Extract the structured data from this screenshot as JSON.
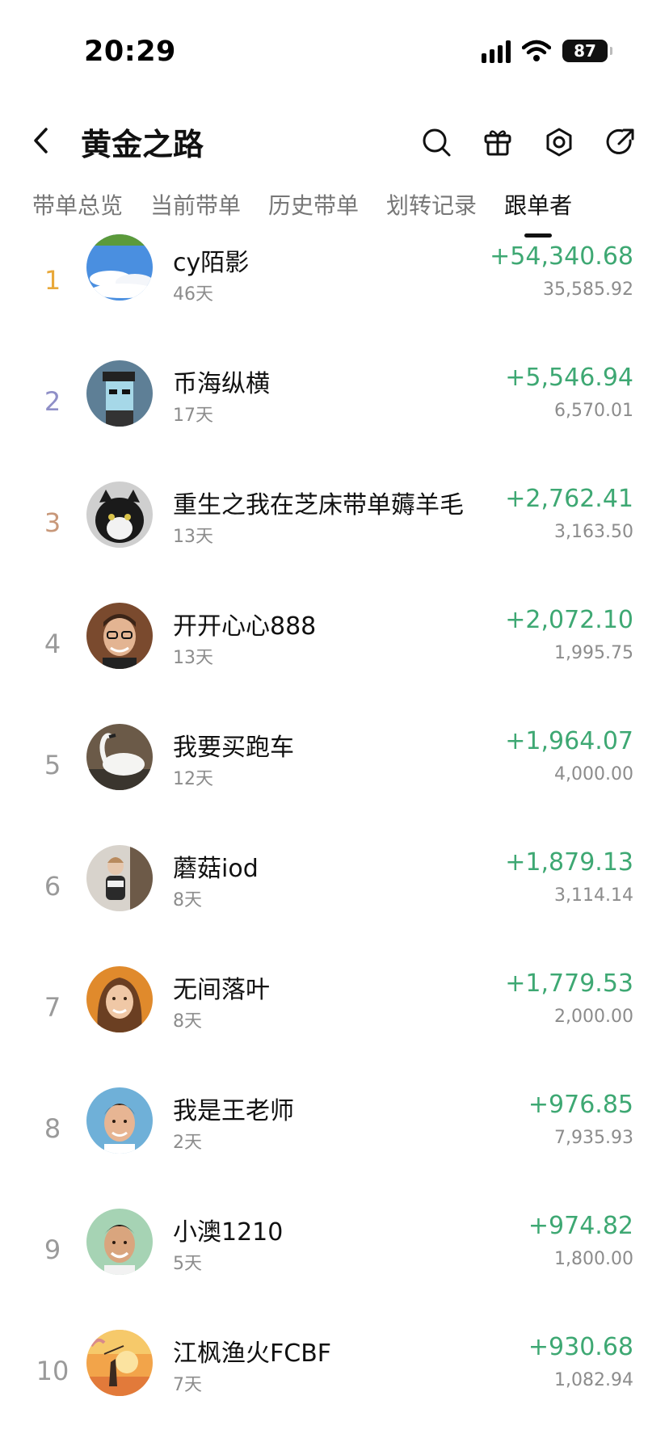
{
  "status_bar": {
    "time": "20:29",
    "battery": "87"
  },
  "header": {
    "title": "黄金之路"
  },
  "tabs": [
    {
      "label": "带单总览",
      "active": false
    },
    {
      "label": "当前带单",
      "active": false
    },
    {
      "label": "历史带单",
      "active": false
    },
    {
      "label": "划转记录",
      "active": false
    },
    {
      "label": "跟单者",
      "active": true
    }
  ],
  "colors": {
    "profit": "#3ea873",
    "rank1": "#e8a83a",
    "rank2": "#8f8fc7",
    "rank3": "#c8987a",
    "muted": "#8c8c8c"
  },
  "followers": [
    {
      "rank": "1",
      "name": "cy陌影",
      "days": "46天",
      "profit": "+54,340.68",
      "amount": "35,585.92"
    },
    {
      "rank": "2",
      "name": "币海纵横",
      "days": "17天",
      "profit": "+5,546.94",
      "amount": "6,570.01"
    },
    {
      "rank": "3",
      "name": "重生之我在芝床带单薅羊毛",
      "days": "13天",
      "profit": "+2,762.41",
      "amount": "3,163.50"
    },
    {
      "rank": "4",
      "name": "开开心心888",
      "days": "13天",
      "profit": "+2,072.10",
      "amount": "1,995.75"
    },
    {
      "rank": "5",
      "name": "我要买跑车",
      "days": "12天",
      "profit": "+1,964.07",
      "amount": "4,000.00"
    },
    {
      "rank": "6",
      "name": "蘑菇iod",
      "days": "8天",
      "profit": "+1,879.13",
      "amount": "3,114.14"
    },
    {
      "rank": "7",
      "name": "无间落叶",
      "days": "8天",
      "profit": "+1,779.53",
      "amount": "2,000.00"
    },
    {
      "rank": "8",
      "name": "我是王老师",
      "days": "2天",
      "profit": "+976.85",
      "amount": "7,935.93"
    },
    {
      "rank": "9",
      "name": "小澳1210",
      "days": "5天",
      "profit": "+974.82",
      "amount": "1,800.00"
    },
    {
      "rank": "10",
      "name": "江枫渔火FCBF",
      "days": "7天",
      "profit": "+930.68",
      "amount": "1,082.94"
    }
  ]
}
